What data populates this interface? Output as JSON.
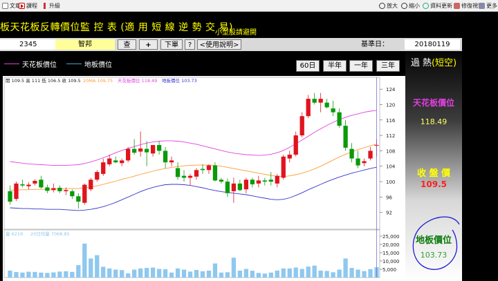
{
  "toolbar": {
    "left": [
      {
        "label": "文章",
        "icon": "document-icon"
      },
      {
        "label": "課程",
        "icon": "video-icon"
      },
      {
        "label": "升級",
        "icon": "upgrade-icon"
      }
    ],
    "right": [
      {
        "label": "放大",
        "icon": "zoom-in-icon"
      },
      {
        "label": "縮小",
        "icon": "zoom-out-icon"
      },
      {
        "label": "資料更新",
        "icon": "refresh-icon"
      },
      {
        "label": "修復視窗",
        "icon": "repair-icon"
      },
      {
        "label": "更多",
        "icon": "more-icon"
      }
    ]
  },
  "header": {
    "title": "板天花板反轉價位監 控 表 (適 用 短 線 逆 勢 交 易)",
    "subtitle": "小型股請避開"
  },
  "inputs": {
    "code": "2345",
    "name": "智邦",
    "search_btn": "查",
    "add_btn": "+",
    "order_btn": "下單",
    "help_q": "?",
    "guide_btn": "<使用說明>",
    "date_label": "基準日：",
    "date_value": "20180119"
  },
  "legend": {
    "ceiling_label": "天花板價位",
    "floor_label": "地板價位",
    "ceiling_color": "#e040e0",
    "floor_color": "#3333cc"
  },
  "periods": [
    "60日",
    "半年",
    "一年",
    "三年"
  ],
  "info": {
    "price_line": "開 109.5 高 111 低 106.5 收 109.5",
    "ma_label": "20MA 109.75",
    "ceiling_label": "天花板價位 118.49",
    "floor_label": "地板價位 103.73",
    "volume_label": "量 6219",
    "volume_ma_label": "20日均量 7068.85"
  },
  "panel": {
    "status": "過 熱",
    "status_paren": "(短空)",
    "ceiling_title": "天花板價位",
    "ceiling_value": "118.49",
    "close_title": "收 盤 價",
    "close_value": "109.5",
    "floor_title": "地板價位",
    "floor_value": "103.73"
  },
  "colors": {
    "up": "#e0141e",
    "down": "#0a9a0a",
    "ma20": "#ff9933",
    "ceiling": "#e040e0",
    "floor": "#3333cc",
    "volume": "#8ec8ef",
    "accent_yellow": "#ffff00"
  },
  "chart_data": {
    "type": "candlestick",
    "ylim": [
      88,
      126
    ],
    "y_ticks": [
      92,
      96,
      100,
      104,
      108,
      112,
      116,
      120,
      124
    ],
    "volume_ticks": [
      "5,000",
      "10,000",
      "15,000",
      "20,000",
      "25,000"
    ],
    "volume_tick_values": [
      5000,
      10000,
      15000,
      20000,
      25000
    ],
    "volume_max": 27500,
    "candles": [
      {
        "o": 97.5,
        "h": 99,
        "l": 94,
        "c": 94.8
      },
      {
        "o": 95.5,
        "h": 100,
        "l": 95,
        "c": 99.5
      },
      {
        "o": 99.3,
        "h": 100.5,
        "l": 98.5,
        "c": 99.0
      },
      {
        "o": 98.8,
        "h": 99.8,
        "l": 98,
        "c": 99.2
      },
      {
        "o": 99.5,
        "h": 100.6,
        "l": 99,
        "c": 100.2
      },
      {
        "o": 100.5,
        "h": 101.5,
        "l": 98.2,
        "c": 98.5
      },
      {
        "o": 98.5,
        "h": 99.2,
        "l": 97,
        "c": 97.6
      },
      {
        "o": 97.8,
        "h": 99.5,
        "l": 97.2,
        "c": 98.3
      },
      {
        "o": 98.4,
        "h": 99,
        "l": 97,
        "c": 97.5
      },
      {
        "o": 97.5,
        "h": 98.5,
        "l": 96.5,
        "c": 97.8
      },
      {
        "o": 97.5,
        "h": 98,
        "l": 95.5,
        "c": 96.2
      },
      {
        "o": 96.2,
        "h": 97,
        "l": 93,
        "c": 94.8
      },
      {
        "o": 94.5,
        "h": 99.5,
        "l": 94,
        "c": 99.2
      },
      {
        "o": 98.0,
        "h": 101,
        "l": 97.5,
        "c": 100.5
      },
      {
        "o": 100.5,
        "h": 103,
        "l": 100,
        "c": 102.5
      },
      {
        "o": 102.0,
        "h": 106,
        "l": 101.5,
        "c": 105
      },
      {
        "o": 104.5,
        "h": 107,
        "l": 104,
        "c": 106
      },
      {
        "o": 105.5,
        "h": 106.5,
        "l": 104.8,
        "c": 105.0
      },
      {
        "o": 104.8,
        "h": 106,
        "l": 104,
        "c": 105.5
      },
      {
        "o": 105.5,
        "h": 109,
        "l": 105,
        "c": 108.5
      },
      {
        "o": 108.5,
        "h": 111,
        "l": 107,
        "c": 107.5
      },
      {
        "o": 107.8,
        "h": 113,
        "l": 106.5,
        "c": 108.6
      },
      {
        "o": 108.5,
        "h": 110.5,
        "l": 104,
        "c": 107.6
      },
      {
        "o": 107.3,
        "h": 109.5,
        "l": 106.5,
        "c": 109.5
      },
      {
        "o": 109.5,
        "h": 110.5,
        "l": 107,
        "c": 108.0
      },
      {
        "o": 108.0,
        "h": 109,
        "l": 103.5,
        "c": 105
      },
      {
        "o": 105.0,
        "h": 106.5,
        "l": 104,
        "c": 105.5
      },
      {
        "o": 103.5,
        "h": 105,
        "l": 100.5,
        "c": 101.2
      },
      {
        "o": 101.5,
        "h": 103,
        "l": 100,
        "c": 101
      },
      {
        "o": 101.0,
        "h": 102,
        "l": 99,
        "c": 101.5
      },
      {
        "o": 101.3,
        "h": 103.5,
        "l": 100.5,
        "c": 103
      },
      {
        "o": 103.3,
        "h": 104.5,
        "l": 102,
        "c": 103.0
      },
      {
        "o": 103.0,
        "h": 104.5,
        "l": 102,
        "c": 104.2
      },
      {
        "o": 104.2,
        "h": 105,
        "l": 100,
        "c": 100.3
      },
      {
        "o": 100.5,
        "h": 101,
        "l": 99.5,
        "c": 100
      },
      {
        "o": 100.0,
        "h": 100.8,
        "l": 96,
        "c": 97
      },
      {
        "o": 97.5,
        "h": 101,
        "l": 94.5,
        "c": 99.5
      },
      {
        "o": 99.5,
        "h": 100.5,
        "l": 97.5,
        "c": 97.8
      },
      {
        "o": 98.0,
        "h": 101,
        "l": 97,
        "c": 100.5
      },
      {
        "o": 100.5,
        "h": 101,
        "l": 98.5,
        "c": 99.3
      },
      {
        "o": 99.5,
        "h": 101.5,
        "l": 98.5,
        "c": 100.3
      },
      {
        "o": 100.3,
        "h": 101,
        "l": 99,
        "c": 100.0
      },
      {
        "o": 100.5,
        "h": 102.5,
        "l": 99,
        "c": 100.0
      },
      {
        "o": 99.5,
        "h": 102,
        "l": 98.5,
        "c": 101.5
      },
      {
        "o": 101.0,
        "h": 107,
        "l": 100.5,
        "c": 106.5
      },
      {
        "o": 106.0,
        "h": 108,
        "l": 105,
        "c": 107
      },
      {
        "o": 107.0,
        "h": 113,
        "l": 106.5,
        "c": 112
      },
      {
        "o": 112.0,
        "h": 118,
        "l": 111.5,
        "c": 117
      },
      {
        "o": 117.0,
        "h": 122.5,
        "l": 116.5,
        "c": 121.5
      },
      {
        "o": 121.5,
        "h": 123,
        "l": 120,
        "c": 120.5
      },
      {
        "o": 120.5,
        "h": 123,
        "l": 118,
        "c": 121.5
      },
      {
        "o": 120.5,
        "h": 121.5,
        "l": 119,
        "c": 119.3
      },
      {
        "o": 119.0,
        "h": 121,
        "l": 117,
        "c": 118
      },
      {
        "o": 118.0,
        "h": 119,
        "l": 114,
        "c": 114.5
      },
      {
        "o": 114.5,
        "h": 116,
        "l": 108,
        "c": 108.8
      },
      {
        "o": 108.5,
        "h": 110,
        "l": 105,
        "c": 106
      },
      {
        "o": 106.0,
        "h": 108,
        "l": 103.5,
        "c": 104.2
      },
      {
        "o": 104.8,
        "h": 106,
        "l": 104,
        "c": 105.3
      },
      {
        "o": 106.0,
        "h": 109,
        "l": 105.5,
        "c": 108
      },
      {
        "o": 109.5,
        "h": 111,
        "l": 106.5,
        "c": 109.5
      }
    ],
    "ma20": [
      97.8,
      97.8,
      97.9,
      97.9,
      98.0,
      98.0,
      98.0,
      98.1,
      98.1,
      98.2,
      98.2,
      98.2,
      98.4,
      98.6,
      98.9,
      99.3,
      99.7,
      100.1,
      100.6,
      101.0,
      101.4,
      101.9,
      102.3,
      102.7,
      103.1,
      103.4,
      103.7,
      103.9,
      104.1,
      104.2,
      104.3,
      104.3,
      104.3,
      104.2,
      104.0,
      103.7,
      103.4,
      103.1,
      102.8,
      102.5,
      102.2,
      101.9,
      101.6,
      101.4,
      101.3,
      101.5,
      101.8,
      102.2,
      102.7,
      103.3,
      104.0,
      104.8,
      105.6,
      106.4,
      107.1,
      107.7,
      108.3,
      108.8,
      109.3,
      109.75
    ],
    "ceiling": [
      105.2,
      105.0,
      104.8,
      104.6,
      104.5,
      104.4,
      104.3,
      104.2,
      104.2,
      104.2,
      104.3,
      104.4,
      104.7,
      105.1,
      105.6,
      106.2,
      106.8,
      107.5,
      108.1,
      108.6,
      109.1,
      109.6,
      110.0,
      110.3,
      110.5,
      110.6,
      110.6,
      110.5,
      110.3,
      110.0,
      109.7,
      109.3,
      108.9,
      108.5,
      108.1,
      107.7,
      107.4,
      107.2,
      107.0,
      106.9,
      106.8,
      106.9,
      107.1,
      107.5,
      108.1,
      108.9,
      109.8,
      110.8,
      111.8,
      112.8,
      113.7,
      114.6,
      115.4,
      116.1,
      116.7,
      117.2,
      117.6,
      118.0,
      118.3,
      118.49
    ],
    "floor": [
      93.2,
      93.1,
      93.0,
      93.0,
      92.9,
      92.9,
      92.8,
      92.8,
      92.8,
      92.7,
      92.6,
      92.5,
      92.6,
      92.8,
      93.1,
      93.5,
      94.0,
      94.6,
      95.3,
      96.0,
      96.7,
      97.4,
      98.0,
      98.5,
      98.9,
      99.2,
      99.3,
      99.3,
      99.2,
      99.0,
      98.7,
      98.4,
      98.0,
      97.7,
      97.4,
      97.2,
      97.0,
      96.8,
      96.6,
      96.3,
      96.0,
      95.7,
      95.4,
      95.3,
      95.4,
      95.8,
      96.4,
      97.1,
      97.9,
      98.6,
      99.3,
      100.0,
      100.6,
      101.2,
      101.7,
      102.2,
      102.6,
      103.0,
      103.4,
      103.73
    ],
    "volume": [
      4200,
      3300,
      3000,
      3500,
      3400,
      3000,
      2800,
      3100,
      3600,
      3800,
      3400,
      7500,
      20500,
      11500,
      13500,
      6500,
      5500,
      4800,
      4500,
      2500,
      4800,
      5500,
      5800,
      6000,
      5200,
      5000,
      3000,
      5500,
      4800,
      3600,
      4600,
      3800,
      4200,
      8500,
      3000,
      3200,
      12000,
      4200,
      5200,
      4100,
      2800,
      2400,
      3000,
      4200,
      5500,
      5500,
      6000,
      5200,
      6600,
      7200,
      4200,
      4000,
      3200,
      4800,
      11500,
      5800,
      4800,
      3900,
      5100,
      6219
    ]
  }
}
